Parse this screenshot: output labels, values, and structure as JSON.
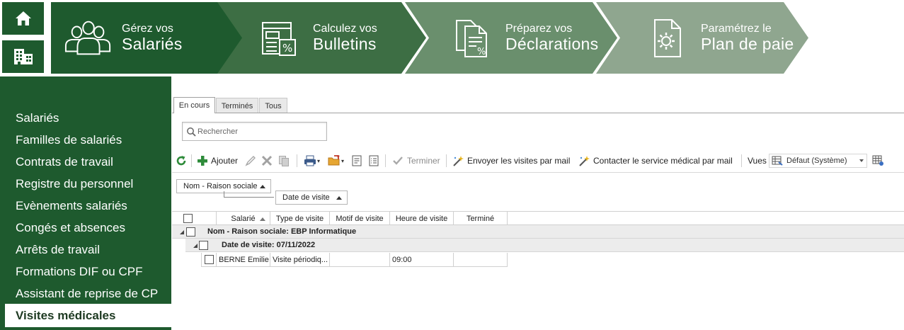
{
  "ribbon": {
    "steps": [
      {
        "small": "Gérez vos",
        "big": "Salariés",
        "icon": "users-icon",
        "color": "#1e5a2e"
      },
      {
        "small": "Calculez vos",
        "big": "Bulletins",
        "icon": "payslip-calculator-icon",
        "color": "#3d6e44"
      },
      {
        "small": "Préparez vos",
        "big": "Déclarations",
        "icon": "declaration-documents-icon",
        "color": "#6a8f6d"
      },
      {
        "small": "Paramétrez le",
        "big": "Plan de paie",
        "icon": "settings-document-icon",
        "color": "#8fa68f"
      }
    ]
  },
  "sidebar": {
    "items": [
      {
        "label": "Salariés"
      },
      {
        "label": "Familles de salariés"
      },
      {
        "label": "Contrats de travail"
      },
      {
        "label": "Registre du personnel"
      },
      {
        "label": "Evènements salariés"
      },
      {
        "label": "Congés et absences"
      },
      {
        "label": "Arrêts de travail"
      },
      {
        "label": "Formations DIF ou CPF"
      },
      {
        "label": "Assistant de reprise de CP"
      },
      {
        "label": "Visites médicales"
      }
    ],
    "active_index": 9
  },
  "tabs": [
    {
      "label": "En cours",
      "active": true
    },
    {
      "label": "Terminés",
      "active": false
    },
    {
      "label": "Tous",
      "active": false
    }
  ],
  "search": {
    "placeholder": "Rechercher",
    "value": ""
  },
  "toolbar": {
    "add_label": "Ajouter",
    "finish_label": "Terminer",
    "send_mail_label": "Envoyer les visites par mail",
    "contact_label": "Contacter le service médical par mail",
    "views_label": "Vues",
    "views_selected": "Défaut (Système)"
  },
  "grouping": {
    "chips": [
      {
        "label": "Nom - Raison sociale"
      },
      {
        "label": "Date de visite"
      }
    ]
  },
  "grid": {
    "columns": [
      {
        "label": "Salarié"
      },
      {
        "label": "Type de visite"
      },
      {
        "label": "Motif de visite"
      },
      {
        "label": "Heure de visite"
      },
      {
        "label": "Terminé"
      }
    ],
    "group1": "Nom - Raison sociale: EBP Informatique",
    "group2": "Date de visite: 07/11/2022",
    "rows": [
      {
        "salarie": "BERNE Emilie",
        "type": "Visite périodiq...",
        "motif": "",
        "heure": "09:00",
        "termine": ""
      }
    ]
  }
}
